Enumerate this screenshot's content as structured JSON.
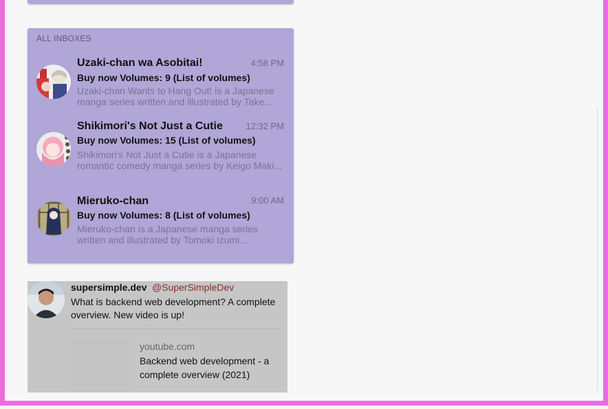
{
  "inbox": {
    "title": "ALL INBOXES",
    "messages": [
      {
        "sender": "Uzaki-chan wa Asobitai!",
        "time": "4:58 PM",
        "subject": "Buy now Volumes: 9 (List of volumes)",
        "preview": "Uzaki-chan Wants to Hang Out! is a Japanese manga series written and illustrated by Take..."
      },
      {
        "sender": "Shikimori's Not Just a Cutie",
        "time": "12:32 PM",
        "subject": "Buy now Volumes: 15 (List of volumes)",
        "preview": "Shikimori's Not Just a Cutie is a Japanese romantic comedy manga series by Keigo Maki..."
      },
      {
        "sender": "Mieruko-chan",
        "time": "9:00 AM",
        "subject": "Buy now Volumes: 8 (List of volumes)",
        "preview": "Mieruko-chan is a Japanese manga series written and illustrated by Tomoki Izumi..."
      }
    ]
  },
  "tweet": {
    "name": "supersimple.dev",
    "handle": "@SuperSimpleDev",
    "text": "What is backend web development? A complete overview. New video is up!",
    "link": {
      "domain": "youtube.com",
      "title": "Backend web development - a complete overview (2021)"
    }
  },
  "colors": {
    "frame_border": "#e96de0",
    "card_bg": "#b0a6d7",
    "tweet_bg": "#c6c6c6",
    "handle": "#8e2a2a"
  }
}
